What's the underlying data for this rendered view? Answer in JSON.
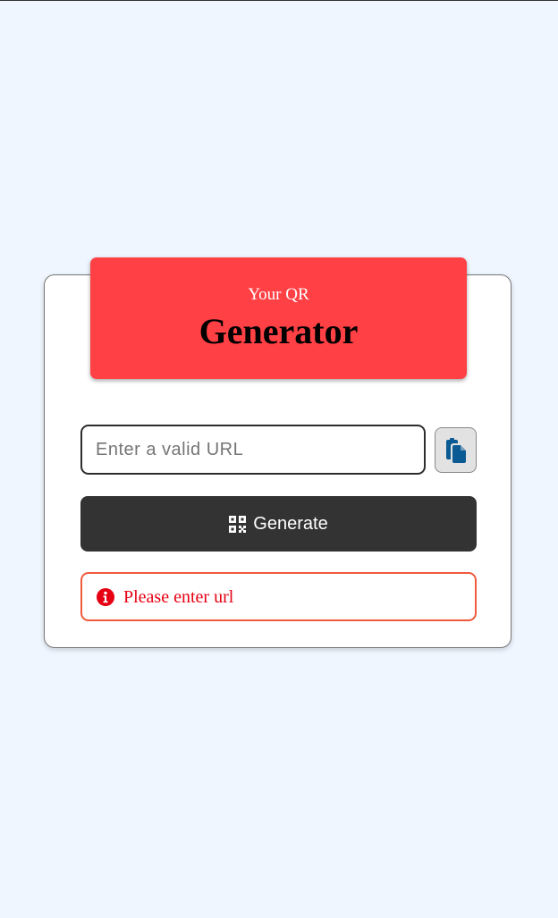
{
  "header": {
    "subtitle": "Your QR",
    "title": "Generator",
    "background": "#ff4044"
  },
  "form": {
    "url_placeholder": "Enter a valid URL",
    "url_value": "",
    "paste_icon": "clipboard-paste-icon",
    "generate_label": "Generate",
    "generate_icon": "qr-code-icon",
    "button_color": "#333333"
  },
  "error": {
    "message": "Please enter url",
    "icon": "info-circle-icon",
    "color": "#e60012",
    "border_color": "#f05a3c"
  },
  "page": {
    "background": "#eff6ff"
  }
}
